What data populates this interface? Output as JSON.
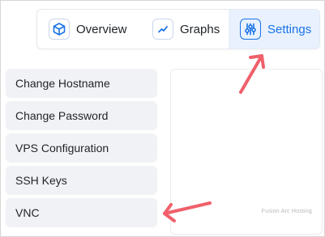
{
  "tabs": [
    {
      "label": "Overview",
      "icon": "box-icon"
    },
    {
      "label": "Graphs",
      "icon": "line-chart-icon"
    },
    {
      "label": "Settings",
      "icon": "sliders-icon",
      "active": true
    }
  ],
  "sidebar": {
    "items": [
      {
        "label": "Change Hostname"
      },
      {
        "label": "Change Password"
      },
      {
        "label": "VPS Configuration"
      },
      {
        "label": "SSH Keys"
      },
      {
        "label": "VNC"
      }
    ]
  },
  "panel": {
    "watermark": "Fusion Arc Hosting"
  },
  "colors": {
    "accent": "#1a73e8",
    "active_tab_bg": "#e8f1fd",
    "annotation_arrow": "#f0606a",
    "sidebar_item_bg": "#f1f2f5"
  }
}
